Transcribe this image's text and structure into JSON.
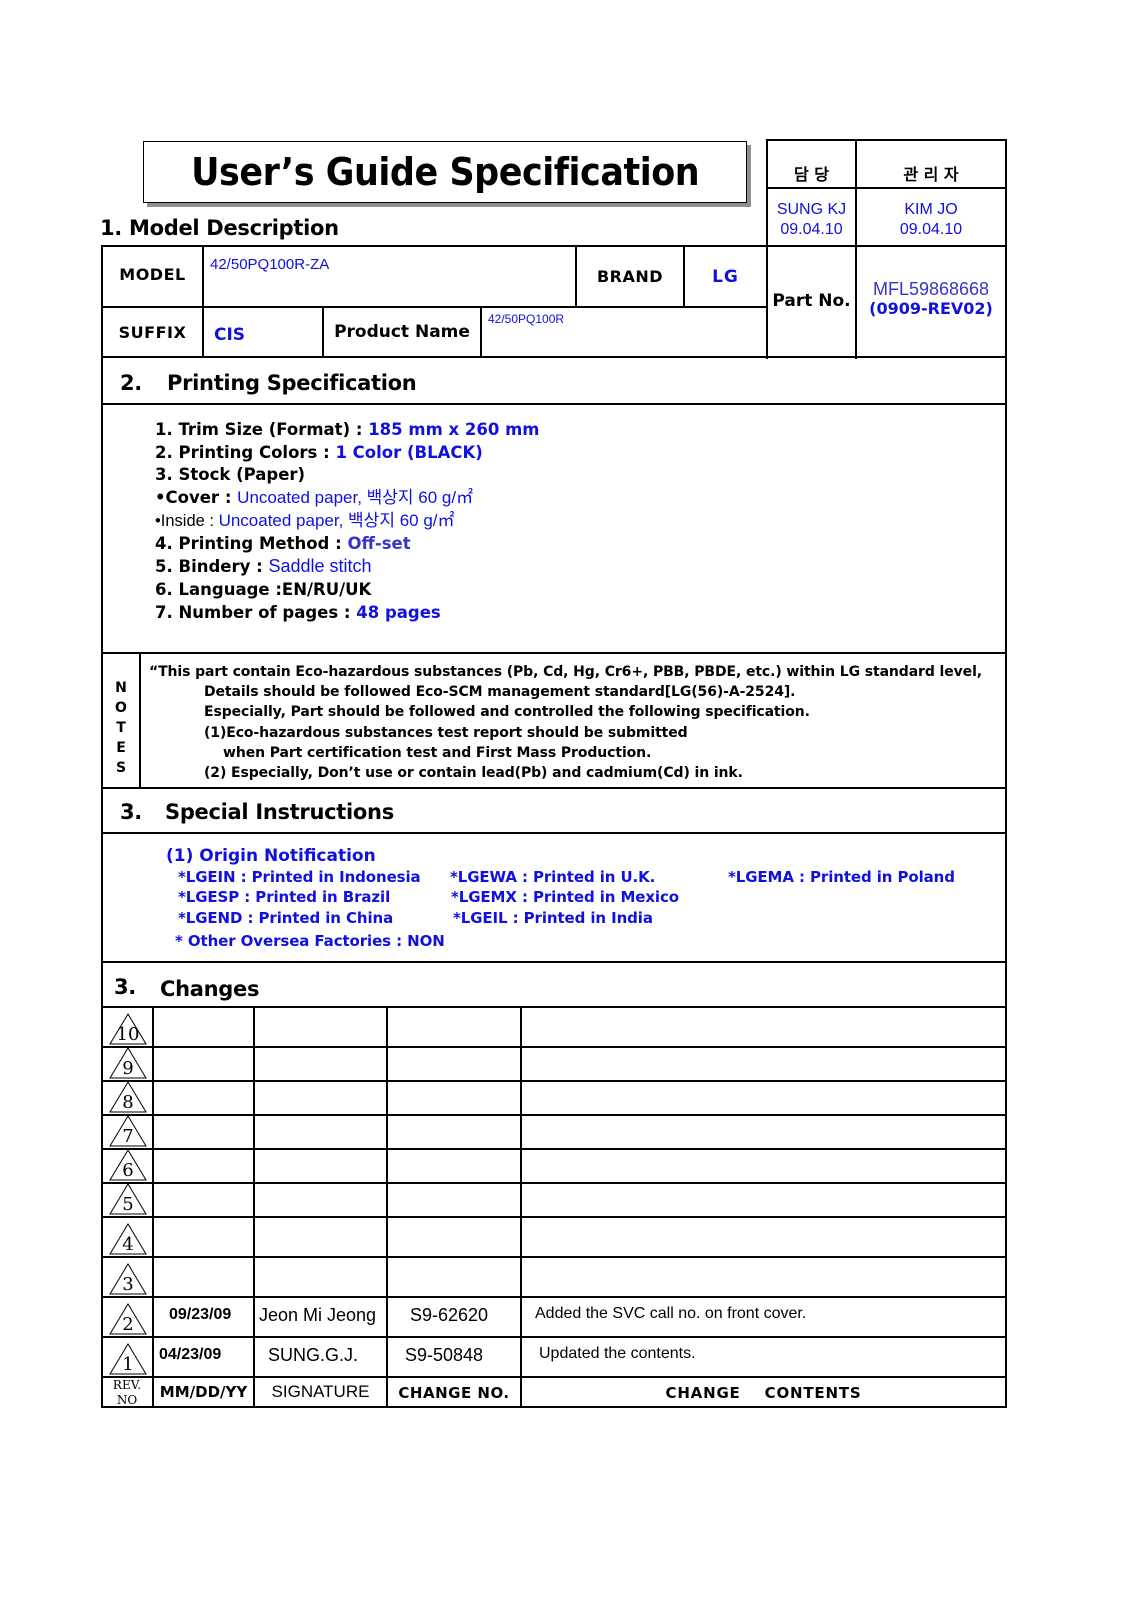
{
  "title": "User’s Guide Specification",
  "approval": {
    "headers": [
      "담  당",
      "관 리 자"
    ],
    "entries": [
      {
        "name": "SUNG KJ",
        "date": "09.04.10"
      },
      {
        "name": "KIM JO",
        "date": "09.04.10"
      }
    ]
  },
  "model_description": {
    "heading": "1. Model Description",
    "model_label": "MODEL",
    "model_value": "42/50PQ100R-ZA",
    "brand_label": "BRAND",
    "brand_value": "LG",
    "suffix_label": "SUFFIX",
    "suffix_value": "CIS",
    "product_name_label": "Product Name",
    "product_name_value": "42/50PQ100R",
    "part_no_label": "Part No.",
    "part_no_value": "MFL59868668",
    "part_no_rev": "(0909-REV02)"
  },
  "printing_spec": {
    "number": "2.",
    "heading": "Printing Specification",
    "items": [
      {
        "label": "1. Trim Size (Format) : ",
        "value": "185 mm x 260 mm"
      },
      {
        "label": "2. Printing Colors : ",
        "value": "1 Color (BLACK)"
      },
      {
        "label": "3. Stock (Paper)",
        "value": ""
      },
      {
        "label": "•Cover : ",
        "value": "Uncoated paper, 백상지 60 g/㎡"
      },
      {
        "label": "•Inside : ",
        "value": "Uncoated paper, 백상지 60 g/㎡"
      },
      {
        "label": "4. Printing Method : ",
        "value": "Off-set"
      },
      {
        "label": "5. Bindery  : ",
        "value": "Saddle stitch"
      },
      {
        "label": "6. Language :EN/RU/UK",
        "value": ""
      },
      {
        "label": "7. Number of pages : ",
        "value": "48 pages"
      }
    ]
  },
  "notes": {
    "side_label": [
      "N",
      "O",
      "T",
      "E",
      "S"
    ],
    "lines": [
      "“This part contain Eco-hazardous substances (Pb, Cd, Hg, Cr6+, PBB, PBDE, etc.) within LG standard level,",
      "Details should be followed Eco-SCM management standard[LG(56)-A-2524].",
      "Especially, Part should be followed and controlled the following specification.",
      "(1)Eco-hazardous substances test report should be submitted",
      "when  Part certification test and First Mass Production.",
      "(2) Especially, Don’t use or contain lead(Pb) and cadmium(Cd) in ink."
    ]
  },
  "special_instructions": {
    "number": "3.",
    "heading": "Special Instructions",
    "origin_title": "(1) Origin Notification",
    "origins": [
      "*LGEIN : Printed in Indonesia",
      "*LGEWA : Printed in U.K.",
      "*LGEMA : Printed in Poland",
      "*LGESP : Printed in Brazil",
      "*LGEMX : Printed in Mexico",
      "*LGEND : Printed in China",
      "*LGEIL : Printed in India",
      "* Other Oversea Factories : NON"
    ]
  },
  "changes": {
    "number": "3.",
    "heading": "Changes",
    "rows": [
      {
        "rev": "10",
        "date": "",
        "signature": "",
        "change_no": "",
        "contents": ""
      },
      {
        "rev": "9",
        "date": "",
        "signature": "",
        "change_no": "",
        "contents": ""
      },
      {
        "rev": "8",
        "date": "",
        "signature": "",
        "change_no": "",
        "contents": ""
      },
      {
        "rev": "7",
        "date": "",
        "signature": "",
        "change_no": "",
        "contents": ""
      },
      {
        "rev": "6",
        "date": "",
        "signature": "",
        "change_no": "",
        "contents": ""
      },
      {
        "rev": "5",
        "date": "",
        "signature": "",
        "change_no": "",
        "contents": ""
      },
      {
        "rev": "4",
        "date": "",
        "signature": "",
        "change_no": "",
        "contents": ""
      },
      {
        "rev": "3",
        "date": "",
        "signature": "",
        "change_no": "",
        "contents": ""
      },
      {
        "rev": "2",
        "date": "09/23/09",
        "signature": "Jeon Mi Jeong",
        "change_no": "S9-62620",
        "contents": "Added the SVC call no. on front cover."
      },
      {
        "rev": "1",
        "date": "04/23/09",
        "signature": "SUNG.G.J.",
        "change_no": "S9-50848",
        "contents": "Updated the contents."
      }
    ],
    "footer": {
      "rev_no": "REV. NO",
      "date": "MM/DD/YY",
      "signature": "SIGNATURE",
      "change_no": "CHANGE NO.",
      "contents": "CHANGE    CONTENTS"
    }
  }
}
